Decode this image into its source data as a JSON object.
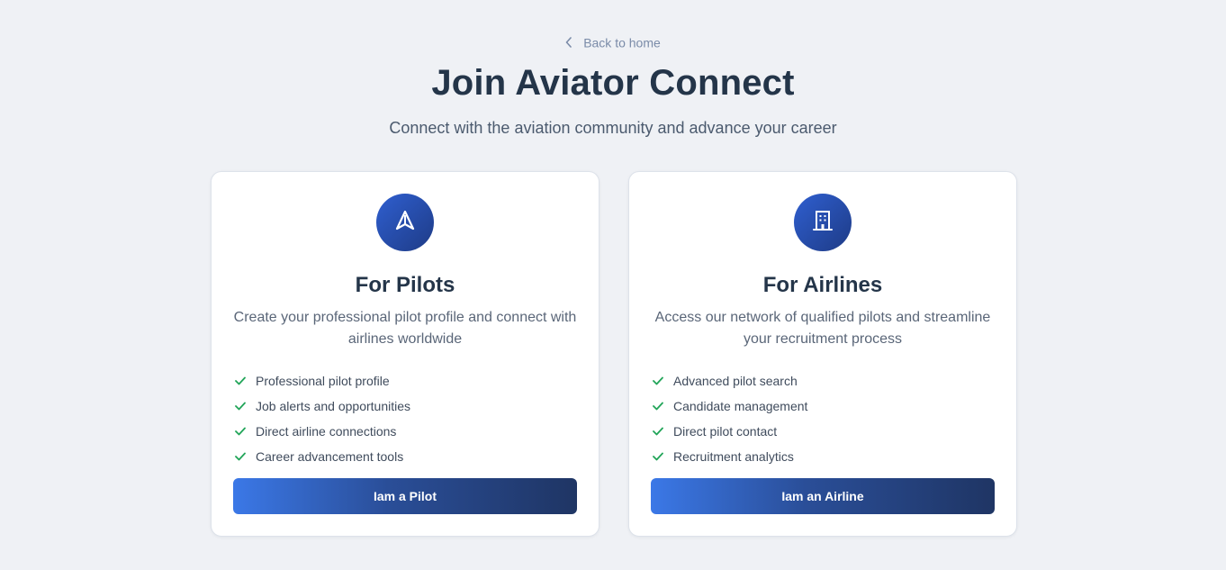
{
  "back_link": {
    "label": "Back to home",
    "icon": "chevron-left-icon"
  },
  "header": {
    "title": "Join Aviator Connect",
    "subtitle": "Connect with the aviation community and advance your career"
  },
  "colors": {
    "accent": "#2f5fd0",
    "accent_dark": "#1f3564",
    "check": "#22a559",
    "background": "#eff1f5"
  },
  "cards": [
    {
      "icon": "navigation-icon",
      "title": "For Pilots",
      "description": "Create your professional pilot profile and connect with airlines worldwide",
      "features": [
        "Professional pilot profile",
        "Job alerts and opportunities",
        "Direct airline connections",
        "Career advancement tools"
      ],
      "button_label": "Iam a Pilot"
    },
    {
      "icon": "building-icon",
      "title": "For Airlines",
      "description": "Access our network of qualified pilots and streamline your recruitment process",
      "features": [
        "Advanced pilot search",
        "Candidate management",
        "Direct pilot contact",
        "Recruitment analytics"
      ],
      "button_label": "Iam an Airline"
    }
  ]
}
